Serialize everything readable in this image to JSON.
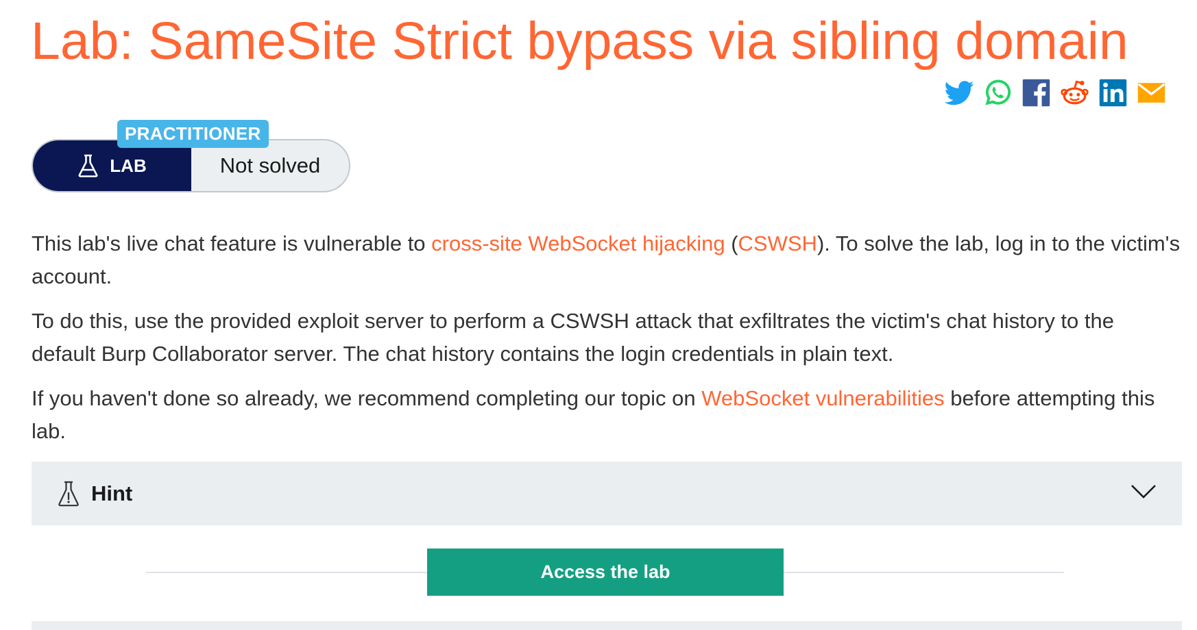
{
  "page": {
    "title": "Lab: SameSite Strict bypass via sibling domain"
  },
  "share": {
    "icons": [
      "twitter-icon",
      "whatsapp-icon",
      "facebook-icon",
      "reddit-icon",
      "linkedin-icon",
      "email-icon"
    ],
    "colors": {
      "twitter": "#1da1f2",
      "whatsapp": "#25d366",
      "facebook": "#3b5998",
      "reddit": "#ff4500",
      "linkedin": "#0077b5",
      "email": "#ffa500"
    }
  },
  "badge": {
    "level": "PRACTITIONER",
    "type_label": "LAB",
    "type_icon": "flask-icon",
    "status": "Not solved"
  },
  "description": {
    "p1_before": "This lab's live chat feature is vulnerable to ",
    "p1_link1": "cross-site WebSocket hijacking",
    "p1_paren_open": " (",
    "p1_link2": "CSWSH",
    "p1_after": "). To solve the lab, log in to the victim's account.",
    "p2": "To do this, use the provided exploit server to perform a CSWSH attack that exfiltrates the victim's chat history to the default Burp Collaborator server. The chat history contains the login credentials in plain text.",
    "p3_before": "If you haven't done so already, we recommend completing our topic on ",
    "p3_link": "WebSocket vulnerabilities",
    "p3_after": " before attempting this lab."
  },
  "hint": {
    "label": "Hint",
    "icon": "hint-flask-icon",
    "chevron": "chevron-down-icon"
  },
  "access": {
    "button_label": "Access the lab"
  },
  "colors": {
    "accent": "#ff6633",
    "lab_badge_bg": "#0a1752",
    "level_tag_bg": "#48b5e9",
    "access_button_bg": "#159f82",
    "hint_bg": "#eaeef1"
  }
}
